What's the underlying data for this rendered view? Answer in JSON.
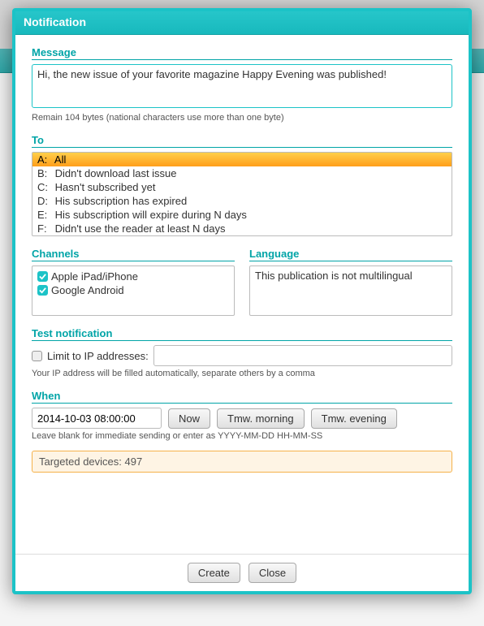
{
  "dialog_title": "Notification",
  "sections": {
    "message": "Message",
    "to": "To",
    "channels": "Channels",
    "language": "Language",
    "test": "Test notification",
    "when": "When"
  },
  "message": {
    "value": "Hi, the new issue of your favorite magazine Happy Evening was published!",
    "remain_hint": "Remain 104 bytes (national characters use more than one byte)"
  },
  "to": {
    "options": [
      {
        "key": "A",
        "label": "All",
        "selected": true
      },
      {
        "key": "B",
        "label": "Didn't download last issue",
        "selected": false
      },
      {
        "key": "C",
        "label": "Hasn't subscribed yet",
        "selected": false
      },
      {
        "key": "D",
        "label": "His subscription has expired",
        "selected": false
      },
      {
        "key": "E",
        "label": "His subscription will expire during N days",
        "selected": false
      },
      {
        "key": "F",
        "label": "Didn't use the reader at least N days",
        "selected": false
      }
    ]
  },
  "channels": {
    "items": [
      {
        "label": "Apple iPad/iPhone",
        "checked": true
      },
      {
        "label": "Google Android",
        "checked": true
      }
    ]
  },
  "language": {
    "text": "This publication is not multilingual"
  },
  "test": {
    "limit_checked": false,
    "limit_label": "Limit to IP addresses:",
    "ip_value": "",
    "hint": "Your IP address will be filled automatically, separate others by a comma"
  },
  "when": {
    "value": "2014-10-03 08:00:00",
    "btn_now": "Now",
    "btn_tmw_morning": "Tmw. morning",
    "btn_tmw_evening": "Tmw. evening",
    "hint": "Leave blank for immediate sending or enter as YYYY-MM-DD HH-MM-SS"
  },
  "target": {
    "text": "Targeted devices: 497"
  },
  "footer": {
    "create": "Create",
    "close": "Close"
  }
}
